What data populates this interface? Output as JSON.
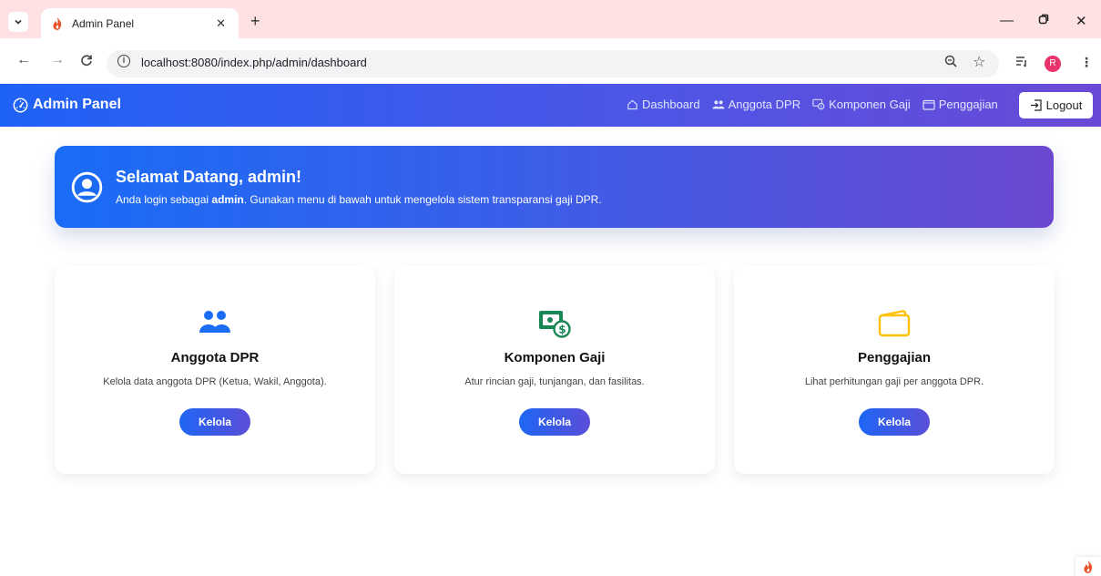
{
  "browser": {
    "tab_title": "Admin Panel",
    "url": "localhost:8080/index.php/admin/dashboard",
    "profile_initial": "R"
  },
  "navbar": {
    "brand": "Admin Panel",
    "links": [
      {
        "label": "Dashboard",
        "icon": "house-icon"
      },
      {
        "label": "Anggota DPR",
        "icon": "people-icon"
      },
      {
        "label": "Komponen Gaji",
        "icon": "cash-icon"
      },
      {
        "label": "Penggajian",
        "icon": "wallet-icon"
      }
    ],
    "logout_label": "Logout",
    "gradient_start": "#1e62f5",
    "gradient_end": "#6a49d6"
  },
  "banner": {
    "title": "Selamat Datang, admin!",
    "sub_prefix": "Anda login sebagai ",
    "sub_user": "admin",
    "sub_suffix": ". Gunakan menu di bawah untuk mengelola sistem transparansi gaji DPR."
  },
  "cards": [
    {
      "title": "Anggota DPR",
      "desc": "Kelola data anggota DPR (Ketua, Wakil, Anggota).",
      "button": "Kelola",
      "icon": "people-icon",
      "icon_color": "#1a6cf6"
    },
    {
      "title": "Komponen Gaji",
      "desc": "Atur rincian gaji, tunjangan, dan fasilitas.",
      "button": "Kelola",
      "icon": "cash-icon",
      "icon_color": "#198754"
    },
    {
      "title": "Penggajian",
      "desc": "Lihat perhitungan gaji per anggota DPR.",
      "button": "Kelola",
      "icon": "wallet-icon",
      "icon_color": "#ffc107"
    }
  ]
}
